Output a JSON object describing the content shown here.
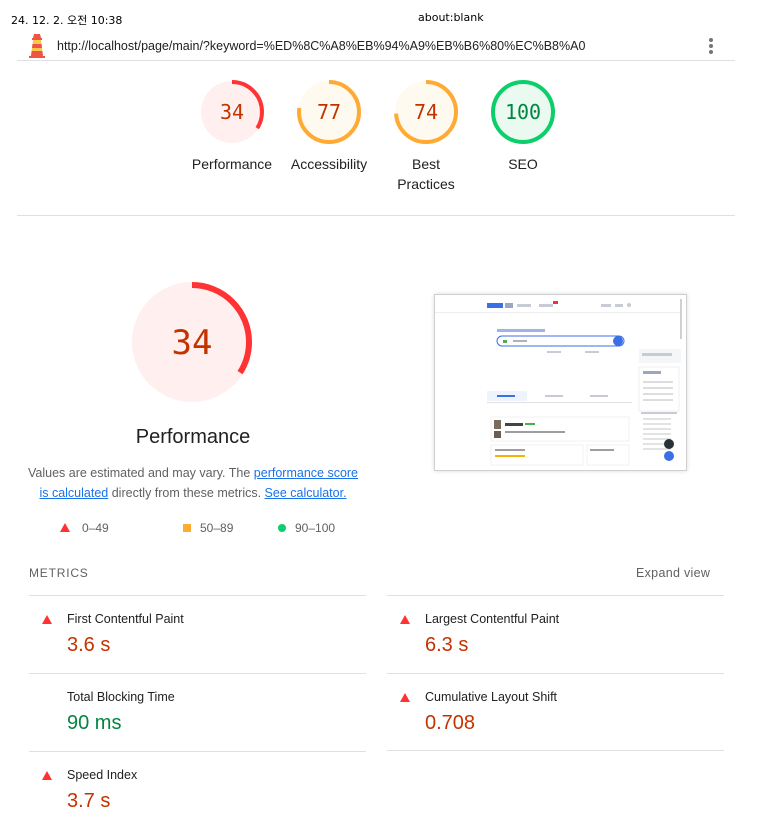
{
  "print": {
    "date": "24. 12. 2. 오전 10:38",
    "title": "about:blank"
  },
  "topbar": {
    "url": "http://localhost/page/main/?keyword=%ED%8C%A8%EB%94%A9%EB%B6%80%EC%B8%A0"
  },
  "gauges": [
    {
      "score": "34",
      "label": "Performance",
      "fraction": 0.34,
      "status": "fail",
      "stroke": "#ff3333",
      "fill": "#fff0ef",
      "text": "#c33300"
    },
    {
      "score": "77",
      "label": "Accessibility",
      "fraction": 0.77,
      "status": "average",
      "stroke": "#ffaa33",
      "fill": "#fffaf0",
      "text": "#c33300"
    },
    {
      "score": "74",
      "label_line1": "Best",
      "label_line2": "Practices",
      "fraction": 0.74,
      "status": "average",
      "stroke": "#ffaa33",
      "fill": "#fffaf0",
      "text": "#c33300"
    },
    {
      "score": "100",
      "label": "SEO",
      "fraction": 1.0,
      "status": "pass",
      "stroke": "#0cce6b",
      "fill": "#eafaf0",
      "text": "#018642"
    }
  ],
  "performance": {
    "score": "34",
    "fraction": 0.34,
    "title": "Performance",
    "desc_pre": "Values are estimated and may vary. The ",
    "desc_link1": "performance score is calculated",
    "desc_mid": " directly from these metrics. ",
    "desc_link2": "See calculator."
  },
  "legend": {
    "fail": "0–49",
    "average": "50–89",
    "pass": "90–100"
  },
  "metrics": {
    "title": "METRICS",
    "expand_label": "Expand view",
    "items": [
      {
        "label": "First Contentful Paint",
        "value": "3.6 s",
        "status": "fail"
      },
      {
        "label": "Largest Contentful Paint",
        "value": "6.3 s",
        "status": "fail"
      },
      {
        "label": "Total Blocking Time",
        "value": "90 ms",
        "status": "pass"
      },
      {
        "label": "Cumulative Layout Shift",
        "value": "0.708",
        "status": "fail"
      },
      {
        "label": "Speed Index",
        "value": "3.7 s",
        "status": "fail"
      }
    ]
  },
  "colors": {
    "fail": "#ff3333",
    "fail_text": "#c33300",
    "average": "#ffaa33",
    "pass": "#0cce6b",
    "pass_text": "#018642",
    "link": "#1a73e8"
  }
}
